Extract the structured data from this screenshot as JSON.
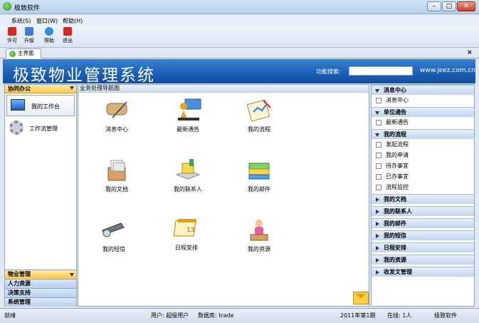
{
  "window": {
    "title": "极致软件"
  },
  "menu": {
    "items": [
      "系统(S)",
      "窗口(W)",
      "帮助(H)"
    ]
  },
  "toolbar": {
    "buttons": [
      {
        "label": "许可",
        "icon": "license-icon",
        "color": "#d7261e"
      },
      {
        "label": "升级",
        "icon": "upgrade-icon",
        "color": "#3a7bd5"
      },
      {
        "label": "帮助",
        "icon": "help-icon",
        "color": "#2f8fd8"
      },
      {
        "label": "退出",
        "icon": "exit-icon",
        "color": "#d7261e"
      }
    ]
  },
  "tabs": [
    {
      "label": "主界面"
    }
  ],
  "banner": {
    "title": "极致物业管理系统",
    "search_label": "功能搜索:",
    "search_value": "",
    "url": "www.jeez.com.cn"
  },
  "left": {
    "header": "协同办公",
    "items": [
      {
        "label": "我的工作台"
      },
      {
        "label": "工作流管理"
      }
    ],
    "sections": [
      "物业管理",
      "人力资源",
      "决策支持",
      "系统管理"
    ]
  },
  "center": {
    "header": "业务处理导航图",
    "icons": [
      {
        "label": "消息中心",
        "icon": "message-center-icon"
      },
      {
        "label": "最新通告",
        "icon": "announcement-icon"
      },
      {
        "label": "我的流程",
        "icon": "workflow-icon"
      },
      {
        "label": "我的文档",
        "icon": "documents-icon"
      },
      {
        "label": "我的联系人",
        "icon": "contacts-icon"
      },
      {
        "label": "我的邮件",
        "icon": "mail-icon"
      },
      {
        "label": "我的短信",
        "icon": "sms-icon"
      },
      {
        "label": "日程安排",
        "icon": "calendar-icon"
      },
      {
        "label": "我的资源",
        "icon": "resources-icon"
      }
    ]
  },
  "right": {
    "groups": [
      {
        "title": "消息中心",
        "open": true,
        "items": [
          "消息中心"
        ]
      },
      {
        "title": "单位通告",
        "open": true,
        "items": [
          "最新通告"
        ]
      },
      {
        "title": "我的流程",
        "open": true,
        "items": [
          "发起流程",
          "我的申请",
          "待办事宜",
          "已办事宜",
          "流程监控"
        ]
      },
      {
        "title": "我的文档",
        "open": false,
        "items": []
      },
      {
        "title": "我的联系人",
        "open": false,
        "items": []
      },
      {
        "title": "我的邮件",
        "open": false,
        "items": []
      },
      {
        "title": "我的短信",
        "open": false,
        "items": []
      },
      {
        "title": "日程安排",
        "open": false,
        "items": []
      },
      {
        "title": "我的资源",
        "open": false,
        "items": []
      },
      {
        "title": "收发文管理",
        "open": false,
        "items": []
      }
    ]
  },
  "status": {
    "state": "就绪",
    "user": "用户: 超级用户",
    "db": "数据库: trade",
    "period": "2011年第1期",
    "online": "在线: 1人",
    "company": "极致软件"
  }
}
